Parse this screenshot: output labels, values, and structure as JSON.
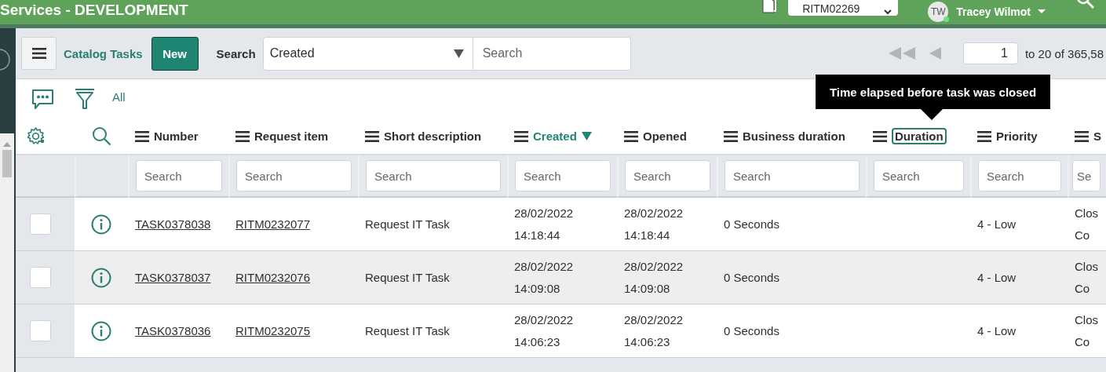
{
  "banner": {
    "title": "Services - DEVELOPMENT",
    "record_picker": "RITM02269",
    "user_initials": "TW",
    "user_name": "Tracey Wilmot"
  },
  "toolbar": {
    "list_title": "Catalog Tasks",
    "new_button": "New",
    "search_label": "Search",
    "search_field": "Created",
    "search_placeholder": "Search",
    "page": "1",
    "range": "to 20 of 365,58"
  },
  "list": {
    "filter_label": "All",
    "columns": [
      {
        "label": "Number",
        "sorted": false,
        "focused": false,
        "placeholder": "Search"
      },
      {
        "label": "Request item",
        "sorted": false,
        "focused": false,
        "placeholder": "Search"
      },
      {
        "label": "Short description",
        "sorted": false,
        "focused": false,
        "placeholder": "Search"
      },
      {
        "label": "Created",
        "sorted": true,
        "focused": false,
        "placeholder": "Search"
      },
      {
        "label": "Opened",
        "sorted": false,
        "focused": false,
        "placeholder": "Search"
      },
      {
        "label": "Business duration",
        "sorted": false,
        "focused": false,
        "placeholder": "Search"
      },
      {
        "label": "Duration",
        "sorted": false,
        "focused": true,
        "placeholder": "Search"
      },
      {
        "label": "Priority",
        "sorted": false,
        "focused": false,
        "placeholder": "Search"
      },
      {
        "label": "S",
        "sorted": false,
        "focused": false,
        "placeholder": "Se"
      }
    ],
    "rows": [
      {
        "checked": false,
        "cells": [
          "TASK0378038",
          "RITM0232077",
          "Request IT Task",
          "28/02/2022 14:18:44",
          "28/02/2022 14:18:44",
          "0 Seconds",
          "",
          "4 - Low",
          "Clos Co"
        ]
      },
      {
        "checked": false,
        "cells": [
          "TASK0378037",
          "RITM0232076",
          "Request IT Task",
          "28/02/2022 14:09:08",
          "28/02/2022 14:09:08",
          "0 Seconds",
          "",
          "4 - Low",
          "Clos Co"
        ]
      },
      {
        "checked": false,
        "cells": [
          "TASK0378036",
          "RITM0232075",
          "Request IT Task",
          "28/02/2022 14:06:23",
          "28/02/2022 14:06:23",
          "0 Seconds",
          "",
          "4 - Low",
          "Clos Co"
        ]
      }
    ],
    "tooltip": "Time elapsed before task was closed"
  }
}
